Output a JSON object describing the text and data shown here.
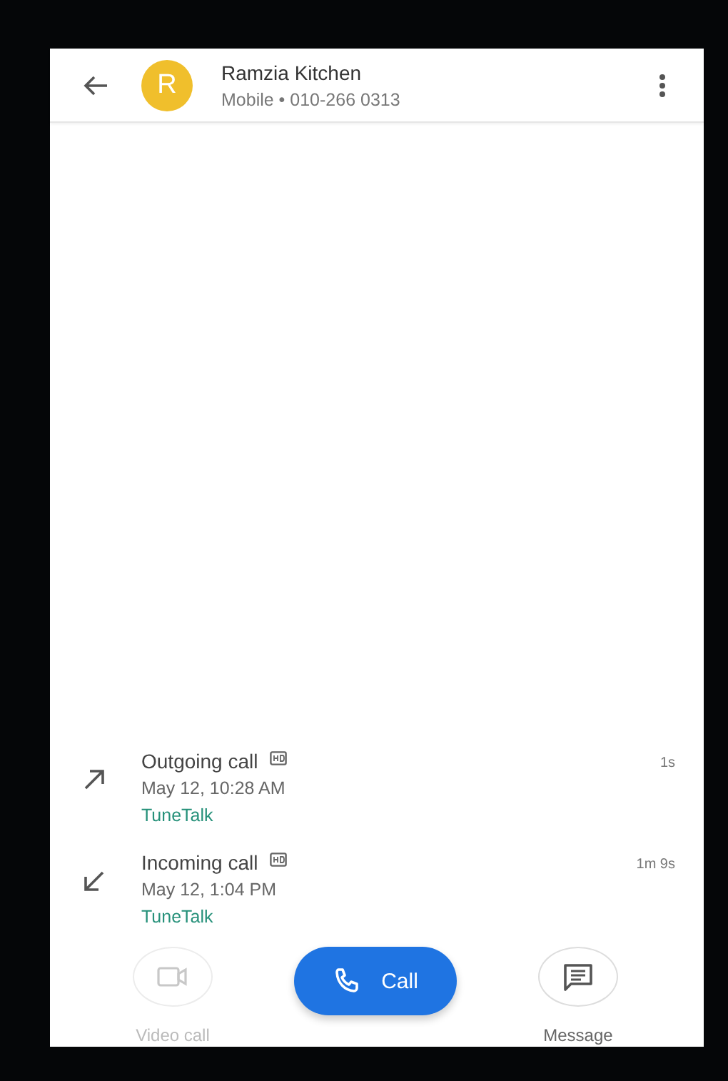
{
  "contact": {
    "initial": "R",
    "name": "Ramzia Kitchen",
    "detail": "Mobile • 010-266 0313"
  },
  "calls": [
    {
      "kind": "outgoing",
      "title": "Outgoing call",
      "hd": true,
      "time": "May 12, 10:28 AM",
      "sim": "TuneTalk",
      "duration": "1s"
    },
    {
      "kind": "incoming",
      "title": "Incoming call",
      "hd": true,
      "time": "May 12, 1:04 PM",
      "sim": "TuneTalk",
      "duration": "1m 9s"
    }
  ],
  "actions": [
    {
      "kind": "video",
      "label": "Video call",
      "disabled": true
    },
    {
      "kind": "call",
      "label": "Call",
      "disabled": false
    },
    {
      "kind": "message",
      "label": "Message",
      "disabled": false
    }
  ]
}
